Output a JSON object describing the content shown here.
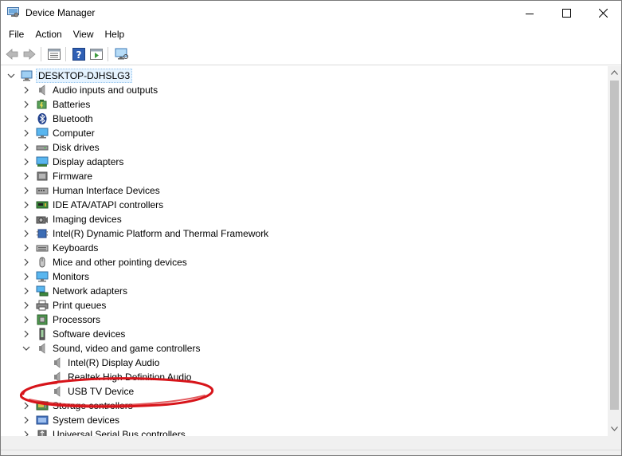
{
  "window": {
    "title": "Device Manager"
  },
  "menu": [
    "File",
    "Action",
    "View",
    "Help"
  ],
  "tree": {
    "root": "DESKTOP-DJHSLG3",
    "categories": [
      {
        "label": "Audio inputs and outputs",
        "icon": "speaker-icon"
      },
      {
        "label": "Batteries",
        "icon": "battery-icon"
      },
      {
        "label": "Bluetooth",
        "icon": "bluetooth-icon"
      },
      {
        "label": "Computer",
        "icon": "computer-icon"
      },
      {
        "label": "Disk drives",
        "icon": "disk-drive-icon"
      },
      {
        "label": "Display adapters",
        "icon": "display-adapter-icon"
      },
      {
        "label": "Firmware",
        "icon": "firmware-icon"
      },
      {
        "label": "Human Interface Devices",
        "icon": "hid-icon"
      },
      {
        "label": "IDE ATA/ATAPI controllers",
        "icon": "ide-controller-icon"
      },
      {
        "label": "Imaging devices",
        "icon": "camera-icon"
      },
      {
        "label": "Intel(R) Dynamic Platform and Thermal Framework",
        "icon": "chip-icon"
      },
      {
        "label": "Keyboards",
        "icon": "keyboard-icon"
      },
      {
        "label": "Mice and other pointing devices",
        "icon": "mouse-icon"
      },
      {
        "label": "Monitors",
        "icon": "monitor-icon"
      },
      {
        "label": "Network adapters",
        "icon": "network-icon"
      },
      {
        "label": "Print queues",
        "icon": "printer-icon"
      },
      {
        "label": "Processors",
        "icon": "processor-icon"
      },
      {
        "label": "Software devices",
        "icon": "software-device-icon"
      },
      {
        "label": "Sound, video and game controllers",
        "icon": "speaker-icon",
        "expanded": true,
        "children": [
          "Intel(R) Display Audio",
          "Realtek High Definition Audio",
          "USB TV Device"
        ]
      },
      {
        "label": "Storage controllers",
        "icon": "storage-icon"
      },
      {
        "label": "System devices",
        "icon": "system-device-icon"
      },
      {
        "label": "Universal Serial Bus controllers",
        "icon": "usb-icon"
      }
    ]
  },
  "colors": {
    "highlight_ellipse": "#d7141a",
    "selection": "#e5f3ff",
    "accent_blue": "#1e73c8"
  }
}
